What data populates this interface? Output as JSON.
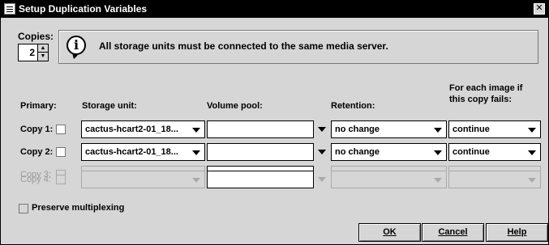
{
  "window": {
    "title": "Setup Duplication Variables",
    "close_glyph": "✕"
  },
  "copies": {
    "label": "Copies:",
    "value": "2"
  },
  "info": {
    "message": "All storage units must be connected to the same media server.",
    "icon": "info-icon"
  },
  "headers": {
    "primary": "Primary:",
    "storage_unit": "Storage unit:",
    "volume_pool": "Volume pool:",
    "retention": "Retention:",
    "on_fail_line1": "For each image if",
    "on_fail_line2": "this copy fails:"
  },
  "rows": [
    {
      "label": "Copy 1:",
      "enabled": true,
      "storage_unit": "cactus-hcart2-01_18...",
      "volume_pool": "",
      "retention": "no change",
      "on_fail": "continue"
    },
    {
      "label": "Copy 2:",
      "enabled": true,
      "storage_unit": "cactus-hcart2-01_18...",
      "volume_pool": "",
      "retention": "no change",
      "on_fail": "continue"
    },
    {
      "label": "Copy 3:",
      "enabled": false,
      "storage_unit": "",
      "volume_pool": "",
      "retention": "",
      "on_fail": ""
    },
    {
      "label": "Copy 4:",
      "enabled": false,
      "storage_unit": "",
      "volume_pool": "",
      "retention": "",
      "on_fail": ""
    }
  ],
  "preserve": {
    "label": "Preserve multiplexing",
    "checked": false
  },
  "buttons": {
    "ok": "OK",
    "cancel": "Cancel",
    "help": "Help"
  }
}
